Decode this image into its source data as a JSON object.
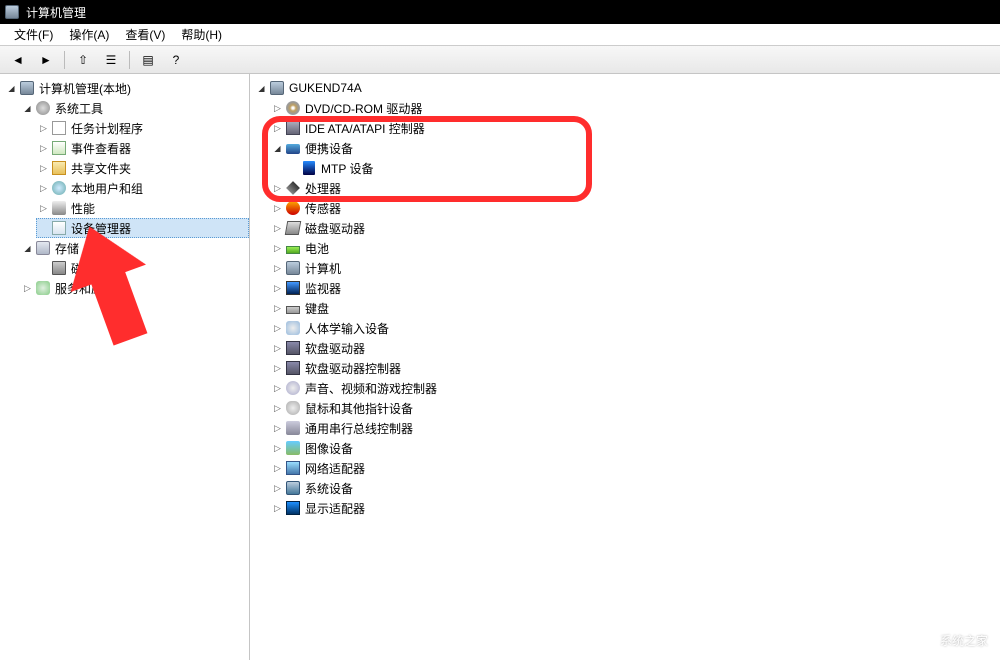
{
  "title": "计算机管理",
  "menu": {
    "file": "文件(F)",
    "action": "操作(A)",
    "view": "查看(V)",
    "help": "帮助(H)"
  },
  "toolbar_icons": [
    "back-icon",
    "forward-icon",
    "up-icon",
    "properties-icon",
    "prop2-icon",
    "help-icon"
  ],
  "left_tree": {
    "root": "计算机管理(本地)",
    "system_tools": "系统工具",
    "items": {
      "task_scheduler": "任务计划程序",
      "event_viewer": "事件查看器",
      "shared_folders": "共享文件夹",
      "local_users": "本地用户和组",
      "performance": "性能",
      "device_manager": "设备管理器"
    },
    "storage": "存储",
    "storage_items": {
      "disk_mgmt": "磁盘管"
    },
    "services": "服务和应"
  },
  "right_tree": {
    "root": "GUKEND74A",
    "items": [
      {
        "k": "dvd",
        "label": "DVD/CD-ROM 驱动器"
      },
      {
        "k": "ide",
        "label": "IDE ATA/ATAPI 控制器"
      },
      {
        "k": "portable",
        "label": "便携设备",
        "expanded": true,
        "children": [
          {
            "k": "mtp",
            "label": "MTP 设备"
          }
        ]
      },
      {
        "k": "cpu",
        "label": "处理器"
      },
      {
        "k": "sensor",
        "label": "传感器"
      },
      {
        "k": "diskdrive",
        "label": "磁盘驱动器"
      },
      {
        "k": "battery",
        "label": "电池"
      },
      {
        "k": "computer",
        "label": "计算机"
      },
      {
        "k": "monitor",
        "label": "监视器"
      },
      {
        "k": "keyboard",
        "label": "键盘"
      },
      {
        "k": "hid",
        "label": "人体学输入设备"
      },
      {
        "k": "floppy",
        "label": "软盘驱动器"
      },
      {
        "k": "floppyc",
        "label": "软盘驱动器控制器"
      },
      {
        "k": "audio",
        "label": "声音、视频和游戏控制器"
      },
      {
        "k": "mouse",
        "label": "鼠标和其他指针设备"
      },
      {
        "k": "usb",
        "label": "通用串行总线控制器"
      },
      {
        "k": "image",
        "label": "图像设备"
      },
      {
        "k": "net",
        "label": "网络适配器"
      },
      {
        "k": "sys",
        "label": "系统设备"
      },
      {
        "k": "display",
        "label": "显示适配器"
      }
    ]
  },
  "watermark": "系统之家"
}
